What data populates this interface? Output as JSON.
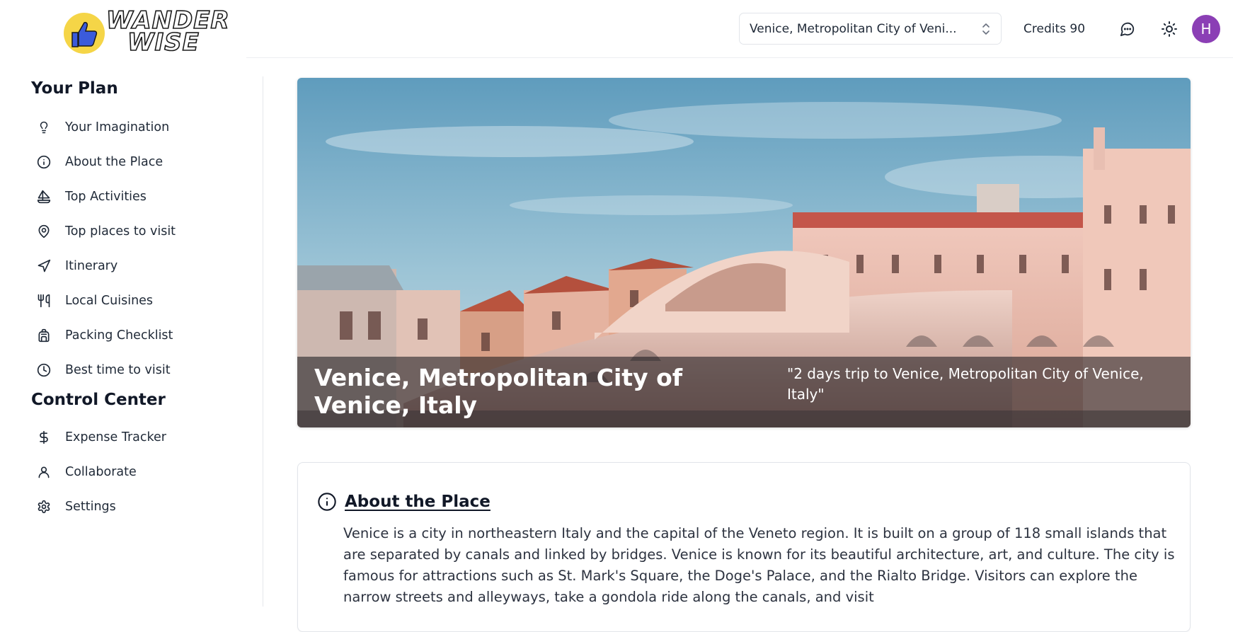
{
  "header": {
    "logo_line1": "WANDER",
    "logo_line2": "WISE",
    "location_value": "Venice, Metropolitan City of Veni...",
    "credits_label": "Credits 90",
    "avatar_initial": "H",
    "icons": [
      "chat-icon",
      "sun-icon",
      "chevrons-up-down-icon"
    ],
    "accent_avatar": "#8b3fb5",
    "logo_badge_color": "#f5d547"
  },
  "sidebar": {
    "plan_title": "Your Plan",
    "plan_items": [
      {
        "label": "Your Imagination",
        "icon": "lightbulb-icon"
      },
      {
        "label": "About the Place",
        "icon": "info-icon"
      },
      {
        "label": "Top Activities",
        "icon": "sailboat-icon"
      },
      {
        "label": "Top places to visit",
        "icon": "map-pin-icon"
      },
      {
        "label": "Itinerary",
        "icon": "navigation-icon"
      },
      {
        "label": "Local Cuisines",
        "icon": "utensils-icon"
      },
      {
        "label": "Packing Checklist",
        "icon": "backpack-icon"
      },
      {
        "label": "Best time to visit",
        "icon": "clock-icon"
      }
    ],
    "control_title": "Control Center",
    "control_items": [
      {
        "label": "Expense Tracker",
        "icon": "dollar-icon"
      },
      {
        "label": "Collaborate",
        "icon": "user-icon"
      },
      {
        "label": "Settings",
        "icon": "gear-icon"
      }
    ]
  },
  "hero": {
    "title": "Venice, Metropolitan City of Venice, Italy",
    "quote": "\"2 days trip to Venice, Metropolitan City of Venice, Italy\""
  },
  "about": {
    "title": "About the Place",
    "text": "Venice is a city in northeastern Italy and the capital of the Veneto region. It is built on a group of 118 small islands that are separated by canals and linked by bridges. Venice is known for its beautiful architecture, art, and culture. The city is famous for attractions such as St. Mark's Square, the Doge's Palace, and the Rialto Bridge. Visitors can explore the narrow streets and alleyways, take a gondola ride along the canals, and visit"
  }
}
